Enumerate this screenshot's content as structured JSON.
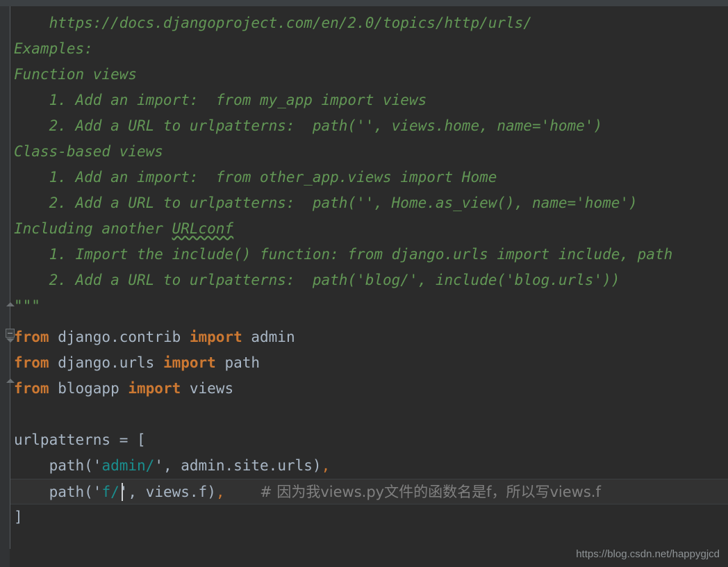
{
  "window": {
    "app": "code-editor",
    "theme": "darcula",
    "background_color": "#2b2b2b",
    "gutter_color": "#313335",
    "top_bar_color": "#3c4043",
    "current_line_color": "#323232"
  },
  "colors": {
    "docstring": "#629755",
    "keyword": "#cc7832",
    "text": "#a9b7c6",
    "string": "#1a8f8f",
    "comment": "#808080",
    "caret": "#cfd2d4"
  },
  "editor": {
    "language": "Python",
    "file": "urls.py",
    "caret": {
      "line": 19,
      "column": 13
    },
    "lines": [
      {
        "n": 1,
        "type": "docstring",
        "indent": 4,
        "text": "https://docs.djangoproject.com/en/2.0/topics/http/urls/"
      },
      {
        "n": 2,
        "type": "docstring",
        "indent": 0,
        "text": "Examples:"
      },
      {
        "n": 3,
        "type": "docstring",
        "indent": 0,
        "text": "Function views"
      },
      {
        "n": 4,
        "type": "docstring",
        "indent": 4,
        "text": "1. Add an import:  from my_app import views"
      },
      {
        "n": 5,
        "type": "docstring",
        "indent": 4,
        "text": "2. Add a URL to urlpatterns:  path('', views.home, name='home')"
      },
      {
        "n": 6,
        "type": "docstring",
        "indent": 0,
        "text": "Class-based views"
      },
      {
        "n": 7,
        "type": "docstring",
        "indent": 4,
        "text": "1. Add an import:  from other_app.views import Home"
      },
      {
        "n": 8,
        "type": "docstring",
        "indent": 4,
        "text": "2. Add a URL to urlpatterns:  path('', Home.as_view(), name='home')"
      },
      {
        "n": 9,
        "type": "docstring",
        "indent": 0,
        "text": "Including another URLconf",
        "misspelled": "URLconf"
      },
      {
        "n": 10,
        "type": "docstring",
        "indent": 4,
        "text": "1. Import the include() function: from django.urls import include, path"
      },
      {
        "n": 11,
        "type": "docstring",
        "indent": 4,
        "text": "2. Add a URL to urlpatterns:  path('blog/', include('blog.urls'))"
      },
      {
        "n": 12,
        "type": "docstring",
        "indent": 0,
        "text": "\"\"\""
      },
      {
        "n": 13,
        "type": "blank",
        "indent": 0,
        "text": ""
      },
      {
        "n": 14,
        "type": "import",
        "indent": 0,
        "text": "from django.contrib import admin"
      },
      {
        "n": 15,
        "type": "import",
        "indent": 0,
        "text": "from django.urls import path"
      },
      {
        "n": 16,
        "type": "import",
        "indent": 0,
        "text": "from blogapp import views"
      },
      {
        "n": 17,
        "type": "blank",
        "indent": 0,
        "text": ""
      },
      {
        "n": 18,
        "type": "code",
        "indent": 0,
        "text": "urlpatterns = ["
      },
      {
        "n": 19,
        "type": "code",
        "indent": 4,
        "text": "path('admin/', admin.site.urls),"
      },
      {
        "n": 20,
        "type": "code",
        "indent": 4,
        "text": "path('f/', views.f),    # 因为我views.py文件的函数名是f，所以写views.f",
        "current": true
      },
      {
        "n": 21,
        "type": "code",
        "indent": 0,
        "text": "]"
      }
    ],
    "tokens": {
      "l1": {
        "doc": "    https://docs.djangoproject.com/en/2.0/topics/http/urls/"
      },
      "l2": {
        "doc": "Examples:"
      },
      "l3": {
        "doc": "Function views"
      },
      "l4": {
        "doc": "    1. Add an import:  from my_app import views"
      },
      "l5": {
        "doc": "    2. Add a URL to urlpatterns:  path('', views.home, name='home')"
      },
      "l6": {
        "doc": "Class-based views"
      },
      "l7": {
        "doc": "    1. Add an import:  from other_app.views import Home"
      },
      "l8": {
        "doc": "    2. Add a URL to urlpatterns:  path('', Home.as_view(), name='home')"
      },
      "l9a": {
        "doc": "Including another "
      },
      "l9b": {
        "doc": "URLconf"
      },
      "l10": {
        "doc": "    1. Import the include() function: from django.urls import include, path"
      },
      "l11": {
        "doc": "    2. Add a URL to urlpatterns:  path('blog/', include('blog.urls'))"
      },
      "l12": {
        "doc": "\"\"\""
      },
      "l14kw1": "from",
      "l14mod": " django.contrib ",
      "l14kw2": "import",
      "l14name": " admin",
      "l15kw1": "from",
      "l15mod": " django.urls ",
      "l15kw2": "import",
      "l15name": " path",
      "l16kw1": "from",
      "l16mod": " blogapp ",
      "l16kw2": "import",
      "l16name": " views",
      "l18": "urlpatterns = [",
      "l19a": "    path(",
      "l19q1": "'",
      "l19s": "admin/",
      "l19q2": "'",
      "l19b": ", admin.site.urls",
      "l19c": ")",
      "l19d": ",",
      "l20a": "    path(",
      "l20q1": "'",
      "l20s": "f/",
      "l20q2": "'",
      "l20b": ", views.f",
      "l20c": ")",
      "l20d": ",",
      "l20comment": "# 因为我views.py文件的函数名是f，所以写views.f",
      "l21": "]"
    }
  },
  "watermark": {
    "text": "https://blog.csdn.net/happygjcd"
  }
}
